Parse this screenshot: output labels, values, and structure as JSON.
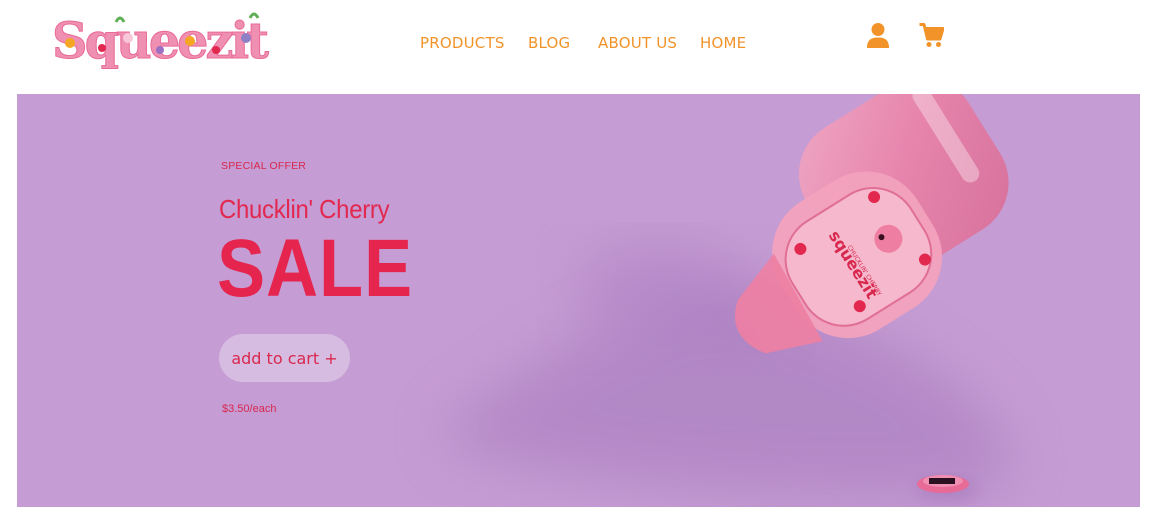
{
  "brand": {
    "logo_text": "Squeezit",
    "colors": {
      "accent": "#f2932a",
      "hero_bg": "#c59cd3",
      "sale_red": "#e5254e",
      "bottle_pink": "#ee7fa3"
    }
  },
  "nav": {
    "items": [
      {
        "label": "PRODUCTS"
      },
      {
        "label": "BLOG"
      },
      {
        "label": "ABOUT US"
      },
      {
        "label": "HOME"
      }
    ]
  },
  "header_icons": [
    "user-icon",
    "cart-icon"
  ],
  "hero": {
    "eyebrow": "SPECIAL OFFER",
    "flavor": "Chucklin' Cherry",
    "headline": "SALE",
    "button_label": "add to cart +",
    "price": "$3.50/each",
    "image": {
      "label_text": "squeezit",
      "label_subtext": "CHUCKLIN' CHERRY"
    }
  }
}
